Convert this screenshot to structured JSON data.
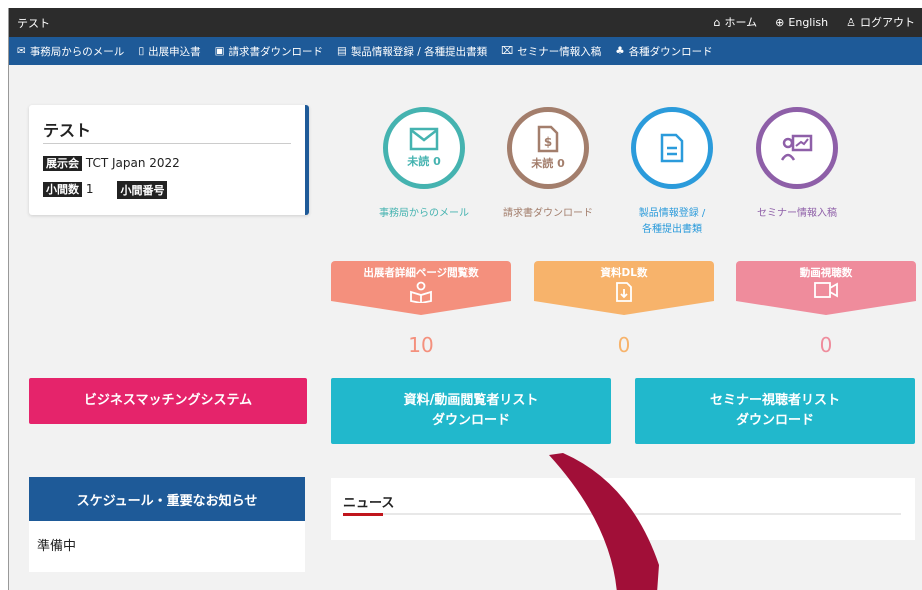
{
  "topbar": {
    "title": "テスト",
    "links": [
      "ホーム",
      "English",
      "ログアウト"
    ]
  },
  "nav": [
    "事務局からのメール",
    "出展申込書",
    "請求書ダウンロード",
    "製品情報登録 / 各種提出書類",
    "セミナー情報入稿",
    "各種ダウンロード"
  ],
  "profile": {
    "name": "テスト",
    "exhibit_tag": "展示会",
    "exhibit_value": "TCT Japan 2022",
    "booths_tag": "小間数",
    "booths_value": "1",
    "booth_no_tag": "小間番号"
  },
  "circles": [
    {
      "inner": "未読 0",
      "label": "事務局からのメール",
      "color": "#45b3b0",
      "icon": "envelope-icon"
    },
    {
      "inner": "未読 0",
      "label": "請求書ダウンロード",
      "color": "#a37e6c",
      "icon": "invoice-icon"
    },
    {
      "inner": "",
      "label": "製品情報登録 /\n各種提出書類",
      "color": "#2b9bdb",
      "icon": "document-icon"
    },
    {
      "inner": "",
      "label": "セミナー情報入稿",
      "color": "#8e5fa8",
      "icon": "presentation-icon"
    }
  ],
  "stats": [
    {
      "title": "出展者詳細ページ閲覧数",
      "value": "10",
      "color": "#f4907d",
      "icon": "book-reader-icon"
    },
    {
      "title": "資料DL数",
      "value": "0",
      "color": "#f7b36b",
      "icon": "file-download-icon"
    },
    {
      "title": "動画視聴数",
      "value": "0",
      "color": "#ef8c9c",
      "icon": "video-icon"
    }
  ],
  "buttons": {
    "matching": "ビジネスマッチングシステム",
    "docs_line1": "資料/動画閲覧者リスト",
    "docs_line2": "ダウンロード",
    "seminar_line1": "セミナー視聴者リスト",
    "seminar_line2": "ダウンロード"
  },
  "schedule": {
    "title": "スケジュール・重要なお知らせ",
    "body": "準備中"
  },
  "news": {
    "title": "ニュース"
  },
  "colors": {
    "nav": "#1e5a98",
    "topbar": "#2c2c2c",
    "matching": "#e5246b",
    "cyan": "#21b8cc",
    "annotation_arrow": "#a10f38"
  }
}
